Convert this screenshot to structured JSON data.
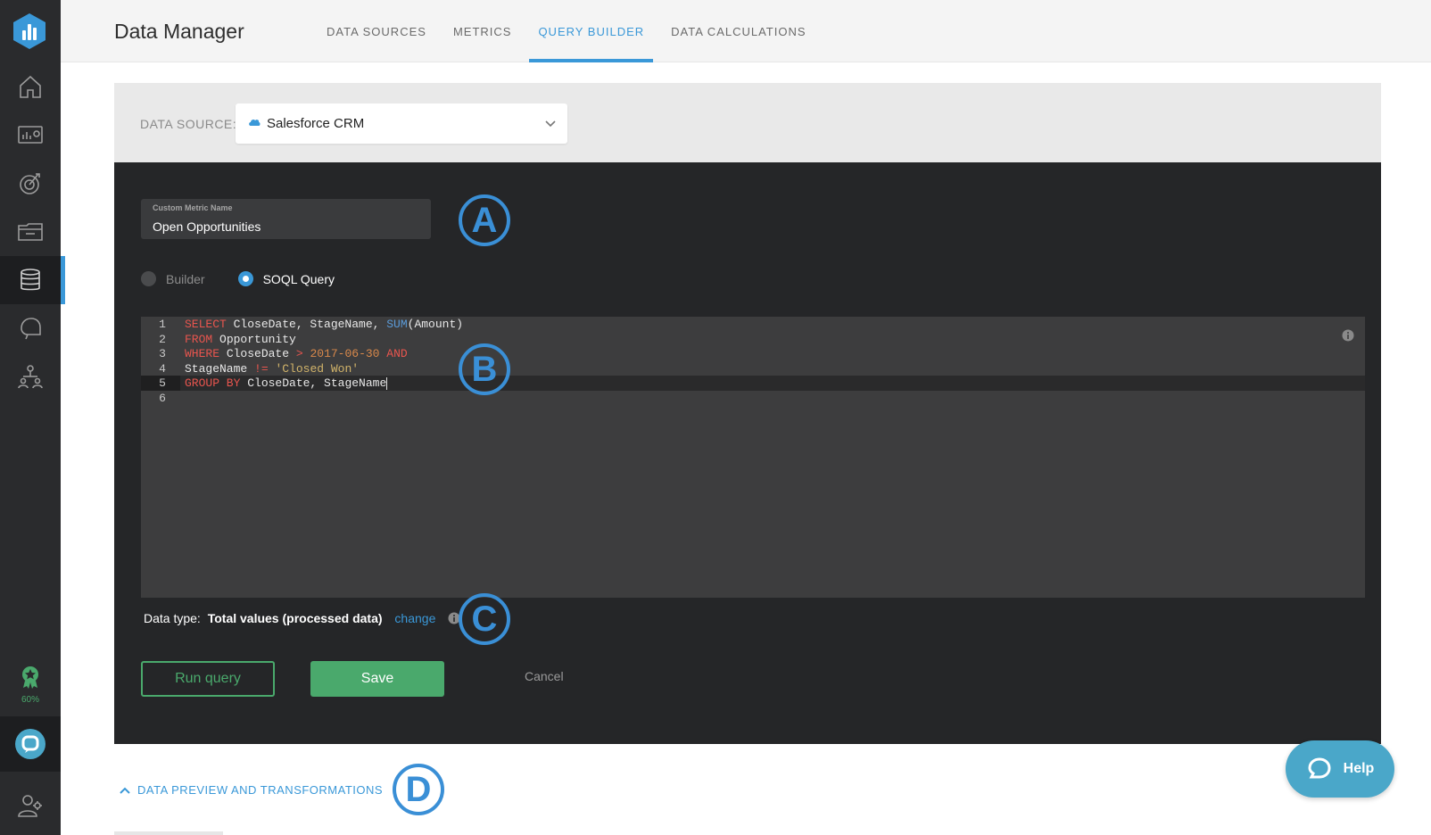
{
  "header": {
    "title": "Data Manager",
    "tabs": [
      {
        "label": "DATA SOURCES"
      },
      {
        "label": "METRICS"
      },
      {
        "label": "QUERY BUILDER"
      },
      {
        "label": "DATA CALCULATIONS"
      }
    ],
    "active_tab": "QUERY BUILDER"
  },
  "sidebar": {
    "items": [
      {
        "icon": "home-icon"
      },
      {
        "icon": "dashboard-icon"
      },
      {
        "icon": "goals-icon"
      },
      {
        "icon": "folder-icon"
      },
      {
        "icon": "database-icon"
      },
      {
        "icon": "alerts-icon"
      },
      {
        "icon": "team-icon"
      }
    ],
    "active_item": "database-icon",
    "progress_pct": "60%"
  },
  "data_source": {
    "label": "DATA SOURCE:",
    "selected": "Salesforce CRM"
  },
  "metric": {
    "field_label": "Custom Metric Name",
    "field_value": "Open Opportunities"
  },
  "mode": {
    "options": [
      {
        "label": "Builder",
        "selected": false
      },
      {
        "label": "SOQL Query",
        "selected": true
      }
    ]
  },
  "editor": {
    "line_numbers": [
      "1",
      "2",
      "3",
      "4",
      "5",
      "6"
    ],
    "current_line": "5",
    "lines": [
      [
        {
          "t": "SELECT",
          "c": "kw"
        },
        {
          "t": " CloseDate, StageName, ",
          "c": ""
        },
        {
          "t": "SUM",
          "c": "fn"
        },
        {
          "t": "(Amount)",
          "c": ""
        }
      ],
      [
        {
          "t": "FROM",
          "c": "kw"
        },
        {
          "t": " Opportunity",
          "c": ""
        }
      ],
      [
        {
          "t": "WHERE",
          "c": "kw"
        },
        {
          "t": " CloseDate ",
          "c": ""
        },
        {
          "t": ">",
          "c": "op"
        },
        {
          "t": " ",
          "c": ""
        },
        {
          "t": "2017-06-30",
          "c": "num"
        },
        {
          "t": " ",
          "c": ""
        },
        {
          "t": "AND",
          "c": "kw"
        }
      ],
      [
        {
          "t": "StageName ",
          "c": ""
        },
        {
          "t": "!=",
          "c": "op"
        },
        {
          "t": " ",
          "c": ""
        },
        {
          "t": "'Closed Won'",
          "c": "str"
        }
      ],
      [
        {
          "t": "GROUP BY",
          "c": "kw"
        },
        {
          "t": " CloseDate, StageName",
          "c": ""
        }
      ],
      []
    ]
  },
  "data_type": {
    "label": "Data type:",
    "value": "Total values (processed data)",
    "change_label": "change"
  },
  "actions": {
    "run_label": "Run query",
    "save_label": "Save",
    "cancel_label": "Cancel"
  },
  "preview": {
    "label": "DATA PREVIEW AND TRANSFORMATIONS"
  },
  "markers": [
    "A",
    "B",
    "C",
    "D"
  ],
  "help": {
    "label": "Help"
  },
  "colors": {
    "accent": "#3a98d8",
    "success": "#4aa96c",
    "sidebar": "#2a2b2d",
    "panel": "#252628",
    "help": "#4aa7c9"
  }
}
